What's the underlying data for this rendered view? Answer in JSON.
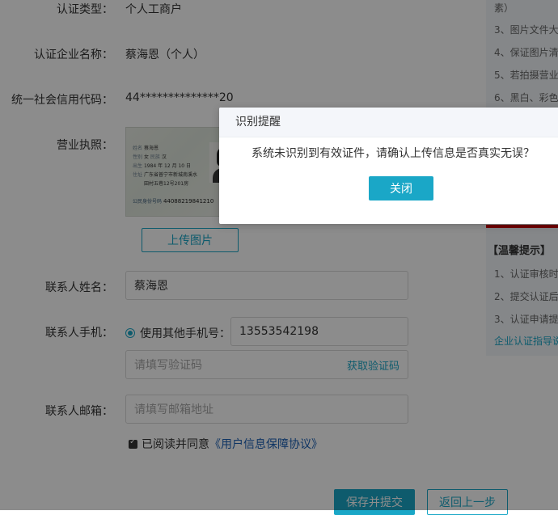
{
  "form": {
    "cert_type_label": "认证类型：",
    "cert_type_value": "个人工商户",
    "company_name_label": "认证企业名称：",
    "company_name_value": "蔡海恩（个人）",
    "credit_code_label": "统一社会信用代码：",
    "credit_code_value": "44**************20",
    "license_label": "营业执照：",
    "upload_button": "上传图片",
    "contact_name_label": "联系人姓名：",
    "contact_name_value": "蔡海恩",
    "contact_phone_label": "联系人手机：",
    "phone_radio_label": "使用其他手机号：",
    "phone_value": "13553542198",
    "code_placeholder": "请填写验证码",
    "get_code_link": "获取验证码",
    "email_label": "联系人邮箱：",
    "email_placeholder": "请填写邮箱地址",
    "agree_prefix": "已阅读并同意",
    "agree_link": "《用户信息保障协议》",
    "submit_button": "保存并提交",
    "back_button": "返回上一步"
  },
  "id_card": {
    "name_field": "姓名",
    "name": "蔡海恩",
    "gender_field": "性别",
    "gender": "女",
    "ethnicity_field": "民族",
    "ethnicity": "汉",
    "birth_field": "出生",
    "birth": "1984 年 12 月 10 日",
    "address_field": "住址",
    "address_1": "广东省普宁市新城南溪水",
    "address_2": "田村五巷12号201房",
    "id_label": "公民身份号码",
    "id_number": "44088219841210"
  },
  "sidebar": {
    "top_tips": [
      "素）",
      "3、图片文件大",
      "4、保证图片清",
      "5、若拍摄营业",
      "6、黑白、彩色"
    ],
    "warm_tips_title": "【温馨提示】",
    "warm_tips": [
      "1、认证审核时",
      "2、提交认证后",
      "3、认证申请提"
    ],
    "guide_link": "企业认证指导说"
  },
  "modal": {
    "title": "识别提醒",
    "message": "系统未识别到有效证件，请确认上传信息是否真实无误？",
    "close_button": "关闭"
  },
  "colors": {
    "primary": "#1aa7c7",
    "link": "#1a5fb4",
    "highlight_red": "#cc0000",
    "overlay": "rgba(0,0,0,0.45)"
  }
}
